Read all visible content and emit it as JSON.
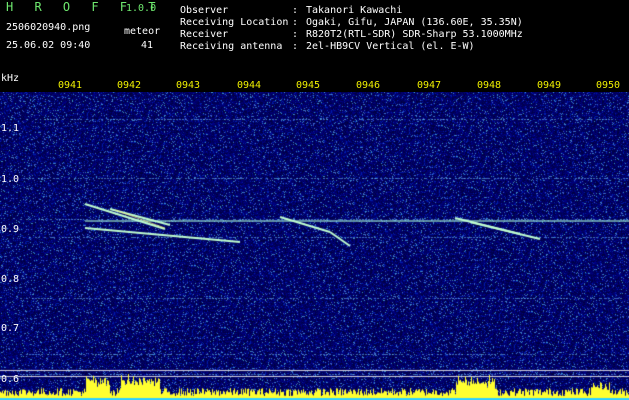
{
  "header": {
    "app_title": "H R O F F T",
    "app_version": "1.0.0",
    "filename": "2506020940.png",
    "meteor_label": "meteor",
    "datetime": "25.06.02 09:40",
    "meteor_count": "41"
  },
  "metadata": [
    {
      "key": "Observer",
      "sep": ":",
      "value": "Takanori Kawachi"
    },
    {
      "key": "Receiving Location",
      "sep": ":",
      "value": "Ogaki, Gifu, JAPAN (136.60E, 35.35N)"
    },
    {
      "key": "Receiver",
      "sep": ":",
      "value": "R820T2(RTL-SDR) SDR-Sharp 53.1000MHz"
    },
    {
      "key": "Receiving antenna",
      "sep": ":",
      "value": "2el-HB9CV Vertical (el. E-W)"
    }
  ],
  "spectrogram": {
    "unit_label": "kHz",
    "time_ticks": [
      "0941",
      "0942",
      "0943",
      "0944",
      "0945",
      "0946",
      "0947",
      "0948",
      "0949",
      "0950"
    ],
    "freq_ticks": [
      "1.1",
      "1.0",
      "0.9",
      "0.8",
      "0.7",
      "0.6"
    ],
    "colors": {
      "background": "#000080",
      "trail": "#b0ffd0",
      "header_text": "#6ee86e",
      "tick_text": "#f0f000",
      "level_bar": "#ffff30"
    }
  }
}
